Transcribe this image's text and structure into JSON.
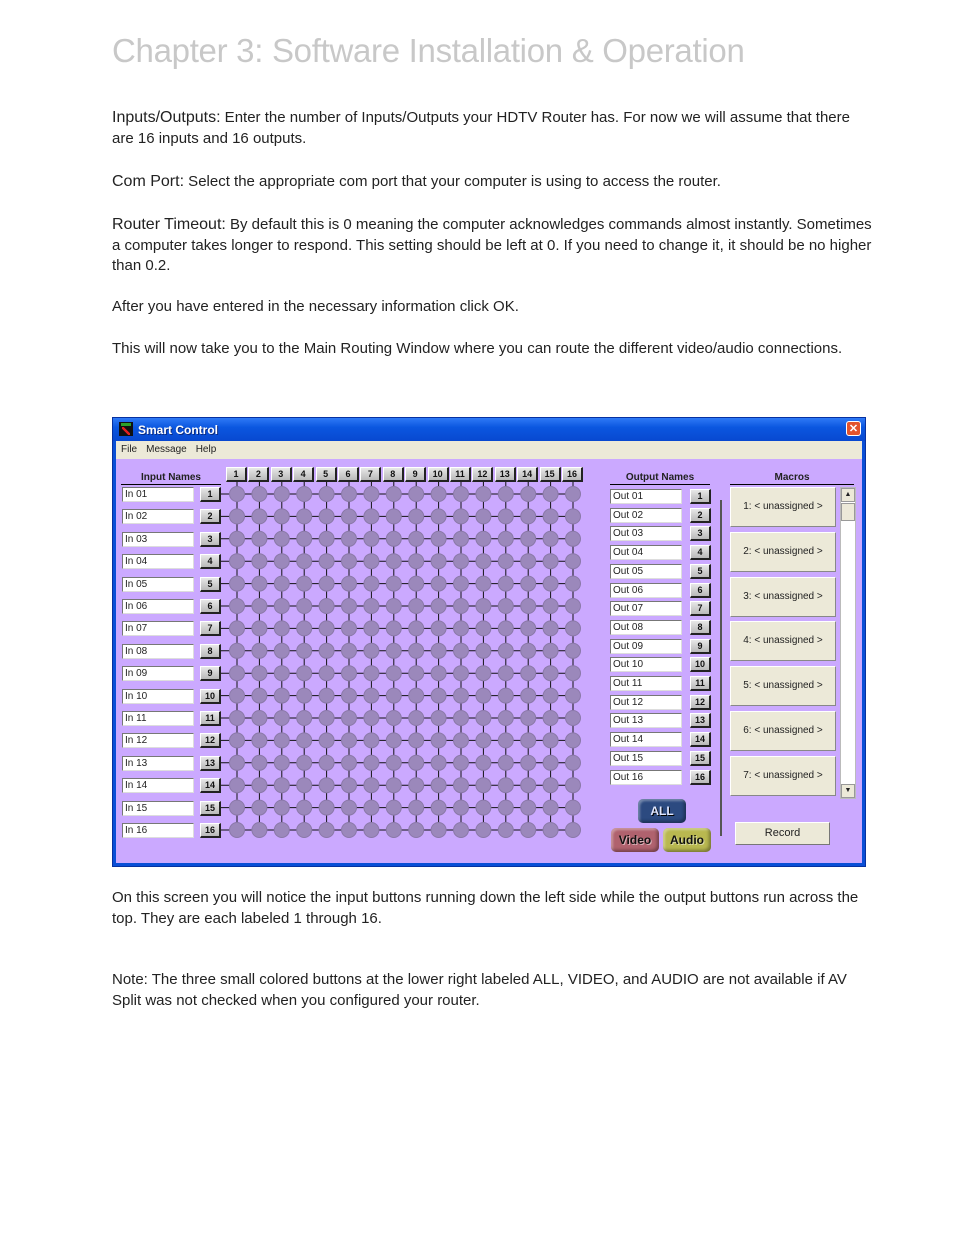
{
  "document": {
    "title": "Chapter 3: Software Installation & Operation",
    "paragraphs": {
      "inputs_outputs": {
        "lead": "Inputs/Outputs:",
        "text": " Enter the number of Inputs/Outputs your HDTV Router has. For now we will assume that there are 16 inputs and 16 outputs."
      },
      "com_port": {
        "lead": "Com Port:",
        "text": " Select the appropriate com port that your computer is using to access the router."
      },
      "router_timeout": {
        "lead": "Router Timeout:",
        "text": " By default this is 0 meaning the computer acknowledges commands almost instantly. Sometimes a computer takes longer to respond. This setting should be left at 0. If you need to change it, it should be no higher than 0.2."
      },
      "after": "After you have entered in the necessary information click OK.",
      "main_window": "This will now take you to the Main Routing Window where you can route the different video/audio connections.",
      "notice": "On this screen you will notice the input buttons running down the left side while the output buttons run across the top. They are each labeled 1 through 16.",
      "note": "Note: The three small colored buttons at the lower right labeled ALL, VIDEO, and AUDIO are not available if AV Split was not checked when you configured your router."
    }
  },
  "window": {
    "title": "Smart Control",
    "close_icon": "close-icon",
    "menu": [
      "File",
      "Message",
      "Help"
    ],
    "input_header": "Input Names",
    "output_header": "Output Names",
    "macros_header": "Macros",
    "inputs": [
      "In 01",
      "In 02",
      "In 03",
      "In 04",
      "In 05",
      "In 06",
      "In 07",
      "In 08",
      "In 09",
      "In 10",
      "In 11",
      "In 12",
      "In 13",
      "In 14",
      "In 15",
      "In 16"
    ],
    "outputs": [
      "Out 01",
      "Out 02",
      "Out 03",
      "Out 04",
      "Out 05",
      "Out 06",
      "Out 07",
      "Out 08",
      "Out 09",
      "Out 10",
      "Out 11",
      "Out 12",
      "Out 13",
      "Out 14",
      "Out 15",
      "Out 16"
    ],
    "numbers": [
      "1",
      "2",
      "3",
      "4",
      "5",
      "6",
      "7",
      "8",
      "9",
      "10",
      "11",
      "12",
      "13",
      "14",
      "15",
      "16"
    ],
    "macros": [
      "1: < unassigned >",
      "2: < unassigned >",
      "3: < unassigned >",
      "4: < unassigned >",
      "5: < unassigned >",
      "6: < unassigned >",
      "7: < unassigned >"
    ],
    "record_label": "Record",
    "all_label": "ALL",
    "video_label": "Video",
    "audio_label": "Audio",
    "colors": {
      "client_bg": "#cba9ff",
      "node": "#9b88bb",
      "all_btn": "#2c4a80",
      "video_btn": "#b0626e",
      "audio_btn": "#b9b850"
    }
  }
}
